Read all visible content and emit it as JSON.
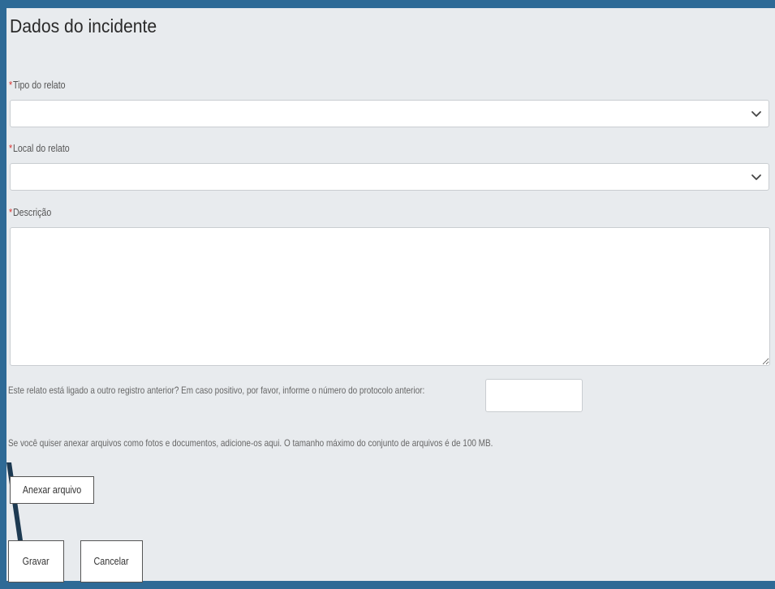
{
  "form": {
    "title": "Dados do incidente",
    "required_marker": "*",
    "tipo_label": "Tipo do relato",
    "local_label": "Local do relato",
    "descricao_label": "Descrição",
    "descricao_value": "",
    "protocol_question": "Este relato está ligado a outro registro anterior? Em caso positivo, por favor, informe o número do protocolo anterior:",
    "protocol_value": "",
    "attach_info": "Se você quiser anexar arquivos como fotos e documentos, adicione-os aqui. O tamanho máximo do conjunto de arquivos é de 100 MB.",
    "attach_button": "Anexar arquivo",
    "save_button": "Gravar",
    "cancel_button": "Cancelar"
  },
  "colors": {
    "background": "#2e6a96",
    "panel": "#e8ebee",
    "required": "#d9312f"
  },
  "icons": {
    "select_chevron": "chevron-down-icon"
  }
}
